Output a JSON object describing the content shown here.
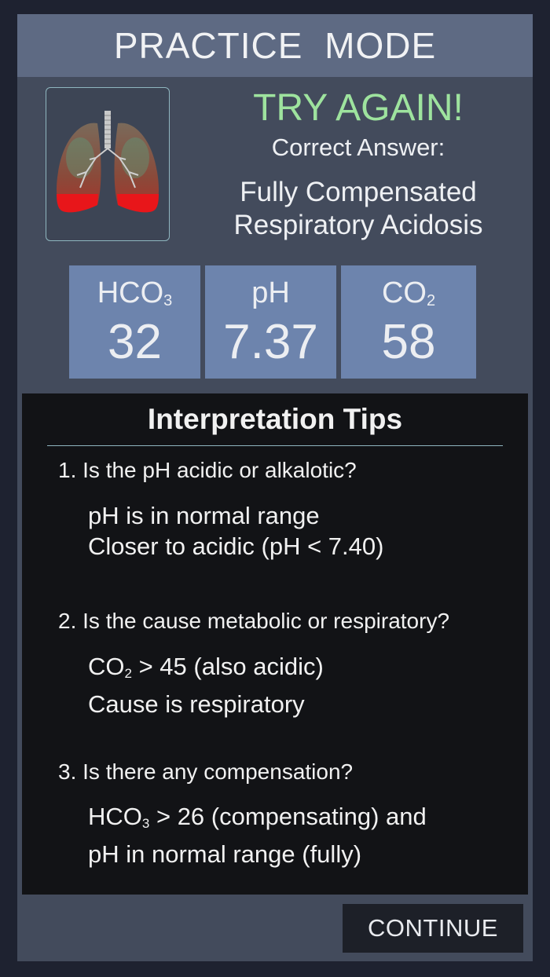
{
  "header": {
    "title": "PRACTICE  MODE"
  },
  "result": {
    "status": "TRY AGAIN!",
    "correct_label": "Correct Answer:",
    "answer_line1": "Fully Compensated",
    "answer_line2": "Respiratory Acidosis"
  },
  "values": {
    "hco3": {
      "label": "HCO",
      "sub": "3",
      "value": "32"
    },
    "ph": {
      "label": "pH",
      "value": "7.37"
    },
    "co2": {
      "label": "CO",
      "sub": "2",
      "value": "58"
    }
  },
  "tips": {
    "title": "Interpretation Tips",
    "q1": "1. Is the pH acidic or alkalotic?",
    "a1_line1": "pH is in normal range",
    "a1_line2": "Closer to acidic (pH < 7.40)",
    "q2": "2. Is the cause metabolic or respiratory?",
    "a2_prefix": "CO",
    "a2_sub": "2",
    "a2_line1_rest": " > 45 (also acidic)",
    "a2_line2": "Cause is respiratory",
    "q3": "3. Is there any compensation?",
    "a3_prefix": "HCO",
    "a3_sub": "3",
    "a3_line1_rest": " > 26 (compensating) and",
    "a3_line2": "pH in normal range (fully)"
  },
  "continue_label": "CONTINUE",
  "colors": {
    "panel": "#434b5c",
    "header": "#5e6a83",
    "value_box": "#6d84ad",
    "try_again": "#9ee39e",
    "tips_bg": "#121316"
  },
  "icons": {
    "lungs": "lungs-icon"
  }
}
